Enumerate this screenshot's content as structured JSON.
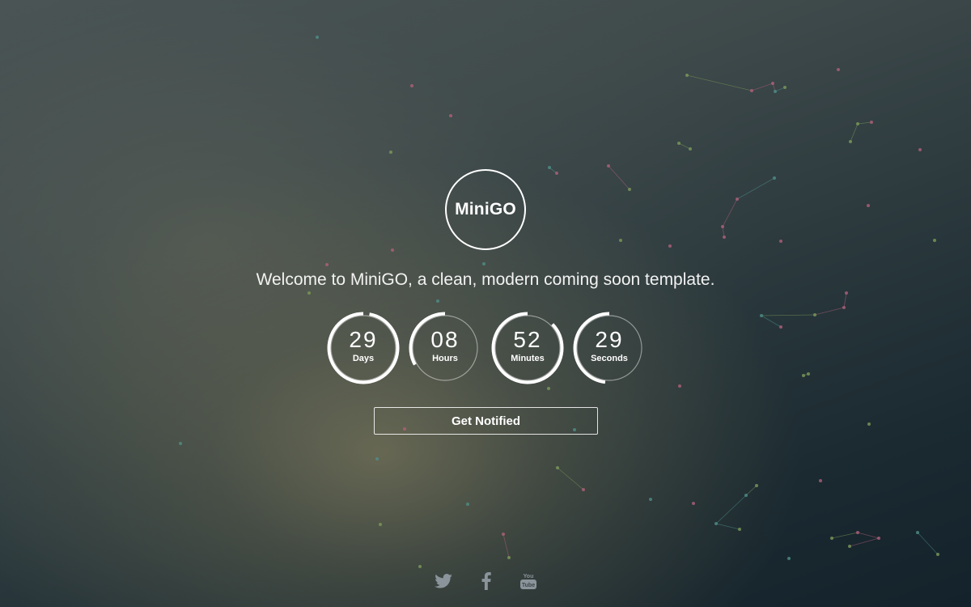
{
  "brand": {
    "logo_text": "MiniGO"
  },
  "welcome": {
    "text": "Welcome to MiniGO, a clean, modern coming soon template."
  },
  "countdown": [
    {
      "value": "29",
      "label": "Days",
      "progress": 0.97
    },
    {
      "value": "08",
      "label": "Hours",
      "progress": 0.33
    },
    {
      "value": "52",
      "label": "Minutes",
      "progress": 0.87
    },
    {
      "value": "29",
      "label": "Seconds",
      "progress": 0.48
    }
  ],
  "cta": {
    "label": "Get Notified"
  },
  "social": [
    {
      "name": "twitter-icon"
    },
    {
      "name": "facebook-icon"
    },
    {
      "name": "youtube-icon",
      "badge_text": "You Tube"
    }
  ],
  "colors": {
    "ring": "#ffffff",
    "ring_track": "rgba(255,255,255,0.45)",
    "social_icon": "#8a949a",
    "particle_pink": "#b0607a",
    "particle_green": "#7d9a5a",
    "particle_teal": "#4f8f88"
  }
}
